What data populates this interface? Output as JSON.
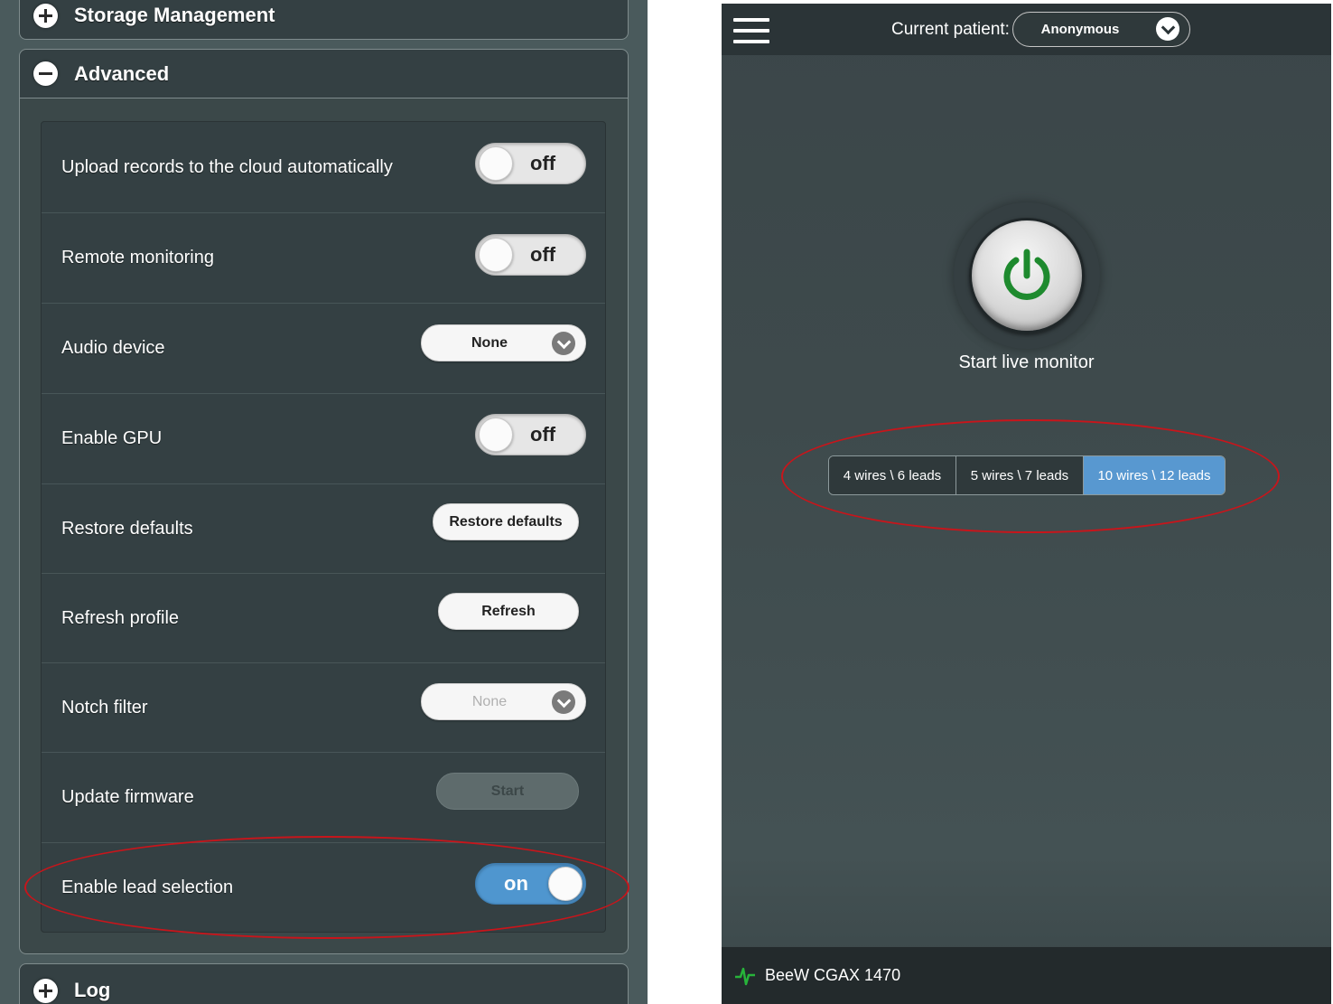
{
  "left": {
    "sections": {
      "storage": "Storage Management",
      "advanced": "Advanced",
      "log": "Log"
    },
    "settings": [
      {
        "label": "Upload records to the cloud automatically",
        "control": "toggle",
        "value": "off"
      },
      {
        "label": "Remote monitoring",
        "control": "toggle",
        "value": "off"
      },
      {
        "label": "Audio device",
        "control": "select",
        "value": "None"
      },
      {
        "label": "Enable GPU",
        "control": "toggle",
        "value": "off"
      },
      {
        "label": "Restore defaults",
        "control": "button",
        "value": "Restore defaults"
      },
      {
        "label": "Refresh profile",
        "control": "button",
        "value": "Refresh"
      },
      {
        "label": "Notch filter",
        "control": "select",
        "value": "None",
        "disabled": true
      },
      {
        "label": "Update firmware",
        "control": "button",
        "value": "Start",
        "disabled": true
      },
      {
        "label": "Enable lead selection",
        "control": "toggle",
        "value": "on"
      }
    ]
  },
  "right": {
    "patient_label": "Current patient:",
    "patient_value": "Anonymous",
    "start_label": "Start live monitor",
    "lead_options": [
      {
        "label": "4 wires \\ 6 leads",
        "active": false
      },
      {
        "label": "5 wires \\ 7 leads",
        "active": false
      },
      {
        "label": "10 wires \\ 12 leads",
        "active": true
      }
    ],
    "device_name": "BeeW CGAX 1470"
  },
  "colors": {
    "accent": "#5898d0",
    "annotation": "#c8151b",
    "power_green": "#1e8a2e"
  },
  "icons": {
    "expand": "plus-circle-icon",
    "collapse": "minus-circle-icon",
    "dropdown": "chevron-down-icon",
    "menu": "hamburger-icon",
    "power": "power-icon",
    "device": "pulse-icon"
  }
}
